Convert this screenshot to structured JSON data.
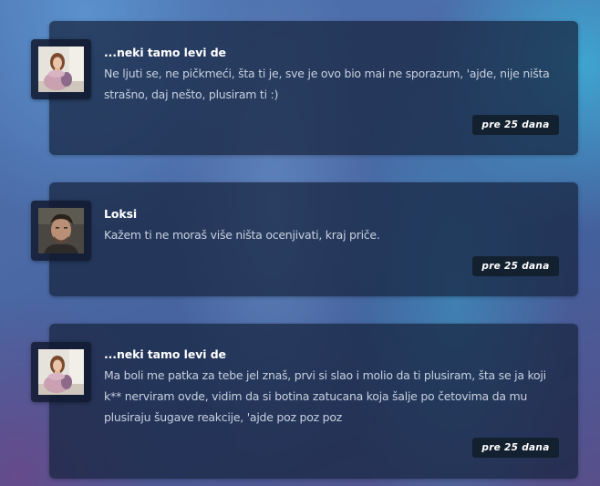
{
  "comments": [
    {
      "author": "...neki tamo levi de",
      "avatar": "woman-portrait-avatar",
      "text": "Ne ljuti se, ne pičkmeći, šta ti je, sve je ovo bio mai ne sporazum, 'ajde, nije ništa strašno, daj nešto, plusiram ti :)",
      "time": "pre 25 dana"
    },
    {
      "author": "Loksi",
      "avatar": "man-portrait-avatar",
      "text": "Kažem ti ne moraš više ništa ocenjivati, kraj priče.",
      "time": "pre 25 dana"
    },
    {
      "author": "...neki tamo levi de",
      "avatar": "woman-portrait-avatar",
      "text": "Ma boli me patka za tebe jel znaš, prvi si slao i molio da ti plusiram, šta se ja koji k** nerviram ovde, vidim da si botina zatucana koja šalje po četovima da mu plusiraju šugave reakcije, 'ajde poz poz poz",
      "time": "pre 25 dana"
    }
  ]
}
